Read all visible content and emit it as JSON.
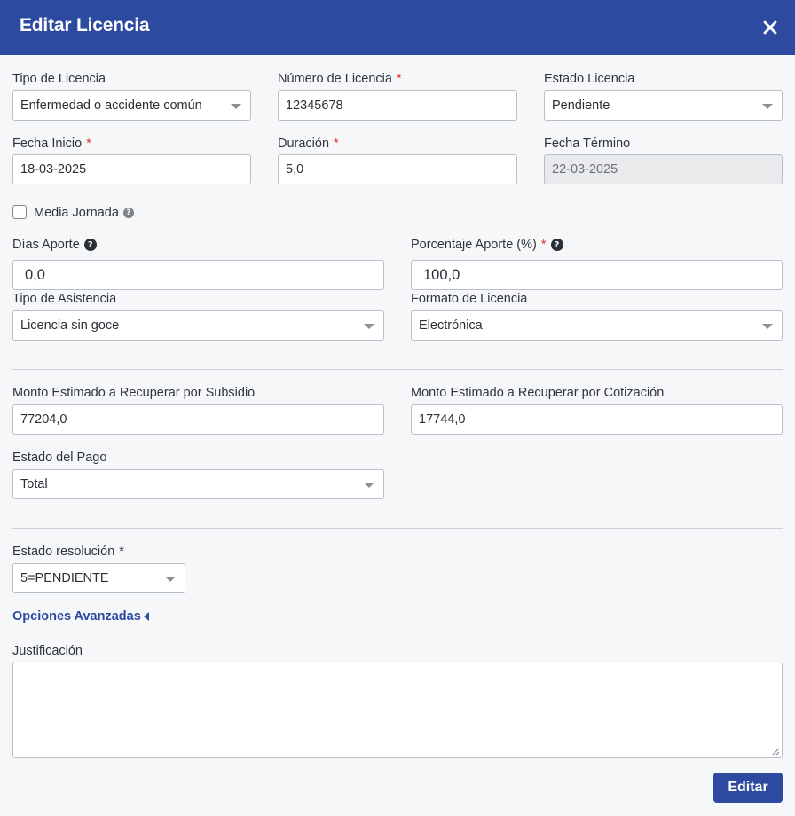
{
  "dialog": {
    "title": "Editar Licencia"
  },
  "tipo_licencia": {
    "label": "Tipo de Licencia",
    "value": "Enfermedad o accidente común"
  },
  "numero_licencia": {
    "label": "Número de Licencia",
    "required_mark": "*",
    "value": "12345678"
  },
  "estado_licencia": {
    "label": "Estado Licencia",
    "value": "Pendiente"
  },
  "fecha_inicio": {
    "label": "Fecha Inicio",
    "required_mark": "*",
    "value": "18-03-2025"
  },
  "duracion": {
    "label": "Duración",
    "required_mark": "*",
    "value": "5,0"
  },
  "fecha_termino": {
    "label": "Fecha Término",
    "value": "22-03-2025"
  },
  "media_jornada": {
    "label": "Media Jornada",
    "checked": false,
    "help": "?"
  },
  "dias_aporte": {
    "label": "Días Aporte",
    "help": "?",
    "value": "0,0"
  },
  "porcentaje_aporte": {
    "label": "Porcentaje Aporte (%)",
    "required_mark": "*",
    "help": "?",
    "value": "100,0"
  },
  "tipo_asistencia": {
    "label": "Tipo de Asistencia",
    "value": "Licencia sin goce"
  },
  "formato_licencia": {
    "label": "Formato de Licencia",
    "value": "Electrónica"
  },
  "monto_subsidio": {
    "label": "Monto Estimado a Recuperar por Subsidio",
    "value": "77204,0"
  },
  "monto_cotizacion": {
    "label": "Monto Estimado a Recuperar por Cotización",
    "value": "17744,0"
  },
  "estado_pago": {
    "label": "Estado del Pago",
    "value": "Total"
  },
  "estado_resolucion": {
    "label": "Estado resolución",
    "required_mark": "*",
    "value": "5=PENDIENTE"
  },
  "opciones_avanzadas": {
    "label": "Opciones Avanzadas"
  },
  "justificacion": {
    "label": "Justificación",
    "value": ""
  },
  "actions": {
    "submit_label": "Editar"
  },
  "colors": {
    "header": "#2c4a9f",
    "accent": "#2c4a9f",
    "required": "#e03131"
  },
  "icons": {
    "close": "close-icon",
    "dropdown": "chevron-down-icon",
    "help": "help-circle-icon",
    "collapse": "caret-left-icon"
  }
}
